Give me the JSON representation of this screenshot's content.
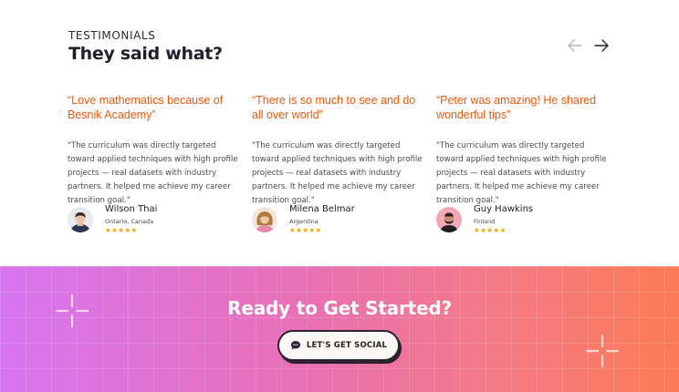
{
  "section": {
    "eyebrow": "TESTIMONIALS",
    "heading": "They said what?"
  },
  "nav": {
    "prev_icon": "arrow-left-icon",
    "next_icon": "arrow-right-icon"
  },
  "testimonials": [
    {
      "quote": "“Love mathematics because of Besnik Academy”",
      "body": "\"The curriculum was directly targeted toward applied techniques with high profile projects — real datasets with industry partners. It helped me achieve my career transition goal.\"",
      "name": "Wilson Thai",
      "location": "Ontario, Canada",
      "stars": "★★★★★",
      "rating": 5
    },
    {
      "quote": "“There is so much to see and do all over world”",
      "body": "\"The curriculum was directly targeted toward applied techniques with high profile projects — real datasets with industry partners. It helped me achieve my career transition goal.\"",
      "name": "Milena Belmar",
      "location": "Argentina",
      "stars": "★★★★★",
      "rating": 5
    },
    {
      "quote": "“Peter was amazing! He shared wonderful tips”",
      "body": "\"The curriculum was directly targeted toward applied techniques with high profile projects — real datasets with industry partners. It helped me achieve my career transition goal.\"",
      "name": "Guy Hawkins",
      "location": "Finland",
      "stars": "★★★★★",
      "rating": 5
    }
  ],
  "cta": {
    "title": "Ready to Get Started?",
    "button_label": "LET'S GET SOCIAL",
    "button_icon": "chat-bubble-icon"
  },
  "colors": {
    "quote": "#e8590c",
    "star": "#f5a300",
    "gradient_start": "#d774f1",
    "gradient_end": "#fb7b55"
  }
}
